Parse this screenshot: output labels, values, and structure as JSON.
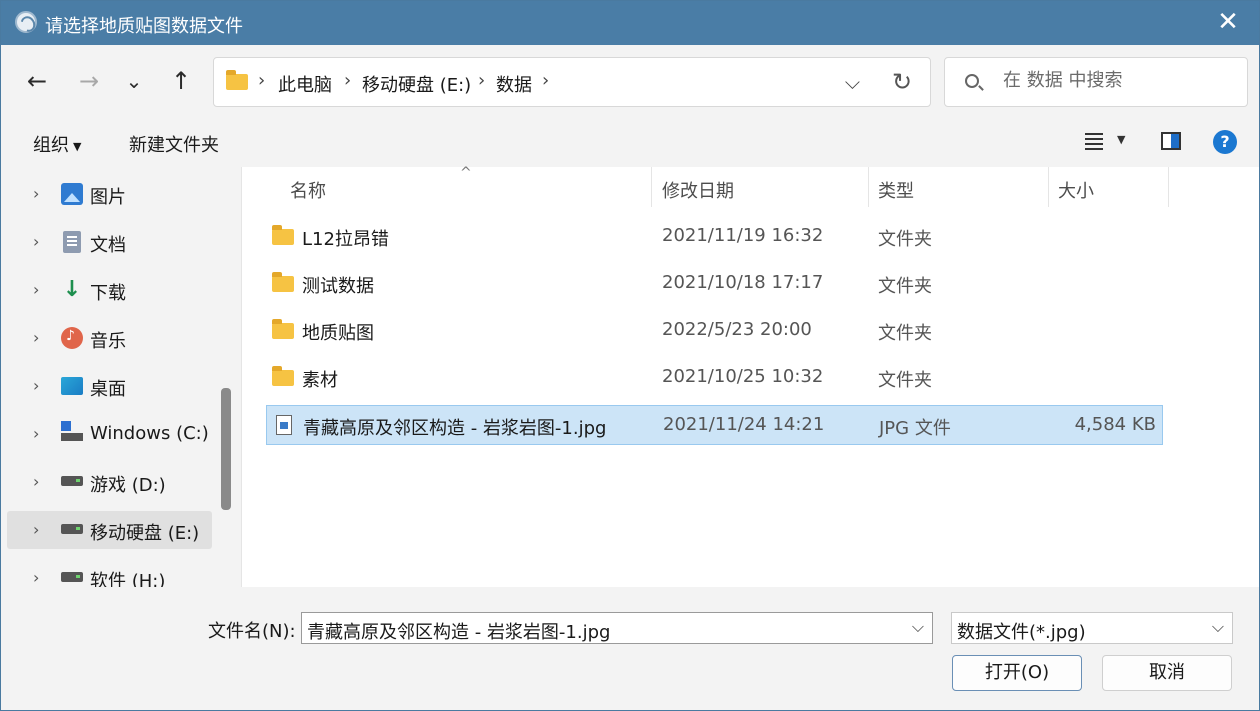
{
  "window": {
    "title": "请选择地质贴图数据文件",
    "close_glyph": "✕"
  },
  "nav": {
    "back_glyph": "←",
    "forward_glyph": "→",
    "recent_glyph": "⌄",
    "up_glyph": "↑",
    "breadcrumb": [
      "此电脑",
      "移动硬盘 (E:)",
      "数据"
    ],
    "separator": "›",
    "dropdown_glyph": "⌵",
    "refresh_glyph": "↻",
    "search_placeholder": "在 数据 中搜索"
  },
  "toolbar": {
    "organize_label": "组织",
    "new_folder_label": "新建文件夹",
    "help_glyph": "?"
  },
  "sidebar": {
    "chevron": "›",
    "items": [
      {
        "label": "图片",
        "icon": "pictures-icon"
      },
      {
        "label": "文档",
        "icon": "documents-icon"
      },
      {
        "label": "下载",
        "icon": "downloads-icon"
      },
      {
        "label": "音乐",
        "icon": "music-icon"
      },
      {
        "label": "桌面",
        "icon": "desktop-icon"
      },
      {
        "label": "Windows (C:)",
        "icon": "windows-drive-icon"
      },
      {
        "label": " 游戏 (D:)",
        "icon": "drive-icon"
      },
      {
        "label": "移动硬盘 (E:)",
        "icon": "drive-icon",
        "selected": true
      },
      {
        "label": "软件 (H:)",
        "icon": "drive-icon"
      }
    ]
  },
  "filelist": {
    "columns": {
      "name": "名称",
      "date": "修改日期",
      "type": "类型",
      "size": "大小"
    },
    "sort_glyph": "^",
    "rows": [
      {
        "name": "L12拉昂错",
        "date": "2021/11/19 16:32",
        "type": "文件夹",
        "size": "",
        "kind": "folder"
      },
      {
        "name": "测试数据",
        "date": "2021/10/18 17:17",
        "type": "文件夹",
        "size": "",
        "kind": "folder"
      },
      {
        "name": "地质贴图",
        "date": "2022/5/23 20:00",
        "type": "文件夹",
        "size": "",
        "kind": "folder"
      },
      {
        "name": "素材",
        "date": "2021/10/25 10:32",
        "type": "文件夹",
        "size": "",
        "kind": "folder"
      },
      {
        "name": "青藏高原及邻区构造 - 岩浆岩图-1.jpg",
        "date": "2021/11/24 14:21",
        "type": "JPG 文件",
        "size": "4,584 KB",
        "kind": "jpg",
        "selected": true
      }
    ]
  },
  "bottom": {
    "filename_label": "文件名(N):",
    "filename_value": "青藏高原及邻区构造 - 岩浆岩图-1.jpg",
    "filetype_value": "数据文件(*.jpg)",
    "dropdown_glyph": "⌵",
    "open_label": "打开(O)",
    "cancel_label": "取消"
  },
  "colors": {
    "titlebar": "#4a7da6",
    "selection": "#cce4f7",
    "accent": "#1b78d1"
  }
}
